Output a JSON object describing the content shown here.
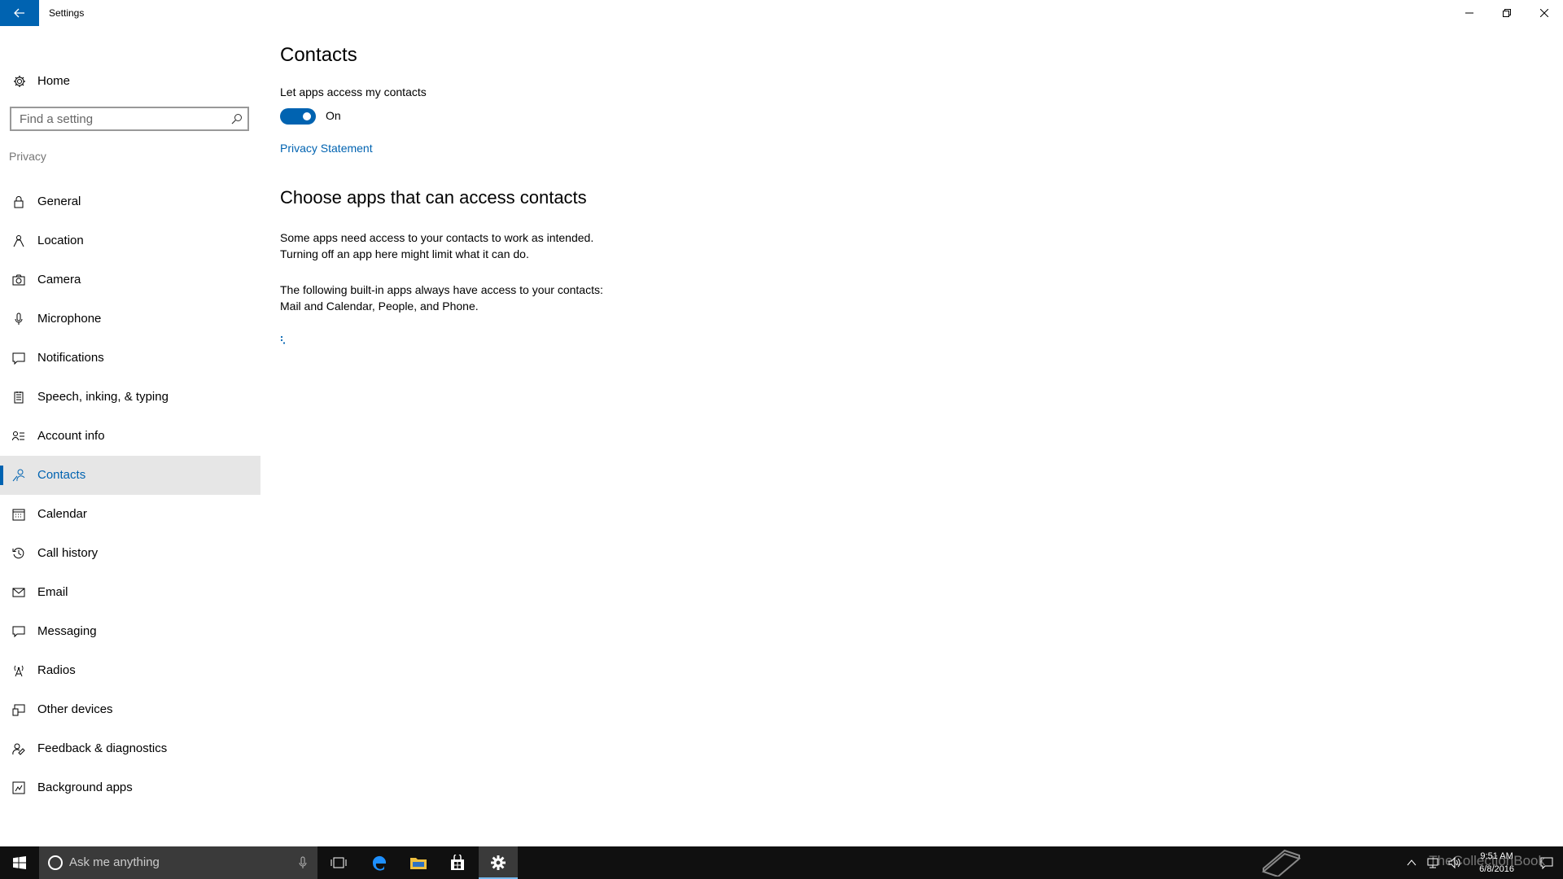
{
  "window": {
    "title": "Settings"
  },
  "sidebar": {
    "home_label": "Home",
    "search_placeholder": "Find a setting",
    "section_label": "Privacy",
    "items": [
      {
        "label": "General",
        "icon": "lock-icon"
      },
      {
        "label": "Location",
        "icon": "location-icon"
      },
      {
        "label": "Camera",
        "icon": "camera-icon"
      },
      {
        "label": "Microphone",
        "icon": "microphone-icon"
      },
      {
        "label": "Notifications",
        "icon": "notifications-icon"
      },
      {
        "label": "Speech, inking, & typing",
        "icon": "speech-icon"
      },
      {
        "label": "Account info",
        "icon": "account-info-icon"
      },
      {
        "label": "Contacts",
        "icon": "contacts-icon",
        "active": true
      },
      {
        "label": "Calendar",
        "icon": "calendar-icon"
      },
      {
        "label": "Call history",
        "icon": "history-icon"
      },
      {
        "label": "Email",
        "icon": "email-icon"
      },
      {
        "label": "Messaging",
        "icon": "messaging-icon"
      },
      {
        "label": "Radios",
        "icon": "radio-tower-icon"
      },
      {
        "label": "Other devices",
        "icon": "devices-icon"
      },
      {
        "label": "Feedback & diagnostics",
        "icon": "feedback-icon"
      },
      {
        "label": "Background apps",
        "icon": "background-apps-icon"
      }
    ]
  },
  "main": {
    "title": "Contacts",
    "toggle_label": "Let apps access my contacts",
    "toggle_state": "On",
    "toggle_on": true,
    "privacy_link": "Privacy Statement",
    "section_title": "Choose apps that can access contacts",
    "para1_line1": "Some apps need access to your contacts to work as intended.",
    "para1_line2": "Turning off an app here might limit what it can do.",
    "para2_line1": "The following built-in apps always have access to your contacts:",
    "para2_line2": "Mail and Calendar, People, and Phone."
  },
  "taskbar": {
    "search_placeholder": "Ask me anything",
    "time": "9:51 AM",
    "date": "6/8/2016",
    "watermark": "TheCollectionBook"
  },
  "colors": {
    "accent": "#0063b1",
    "taskbar": "#101010",
    "selected_bg": "#e6e6e6"
  }
}
